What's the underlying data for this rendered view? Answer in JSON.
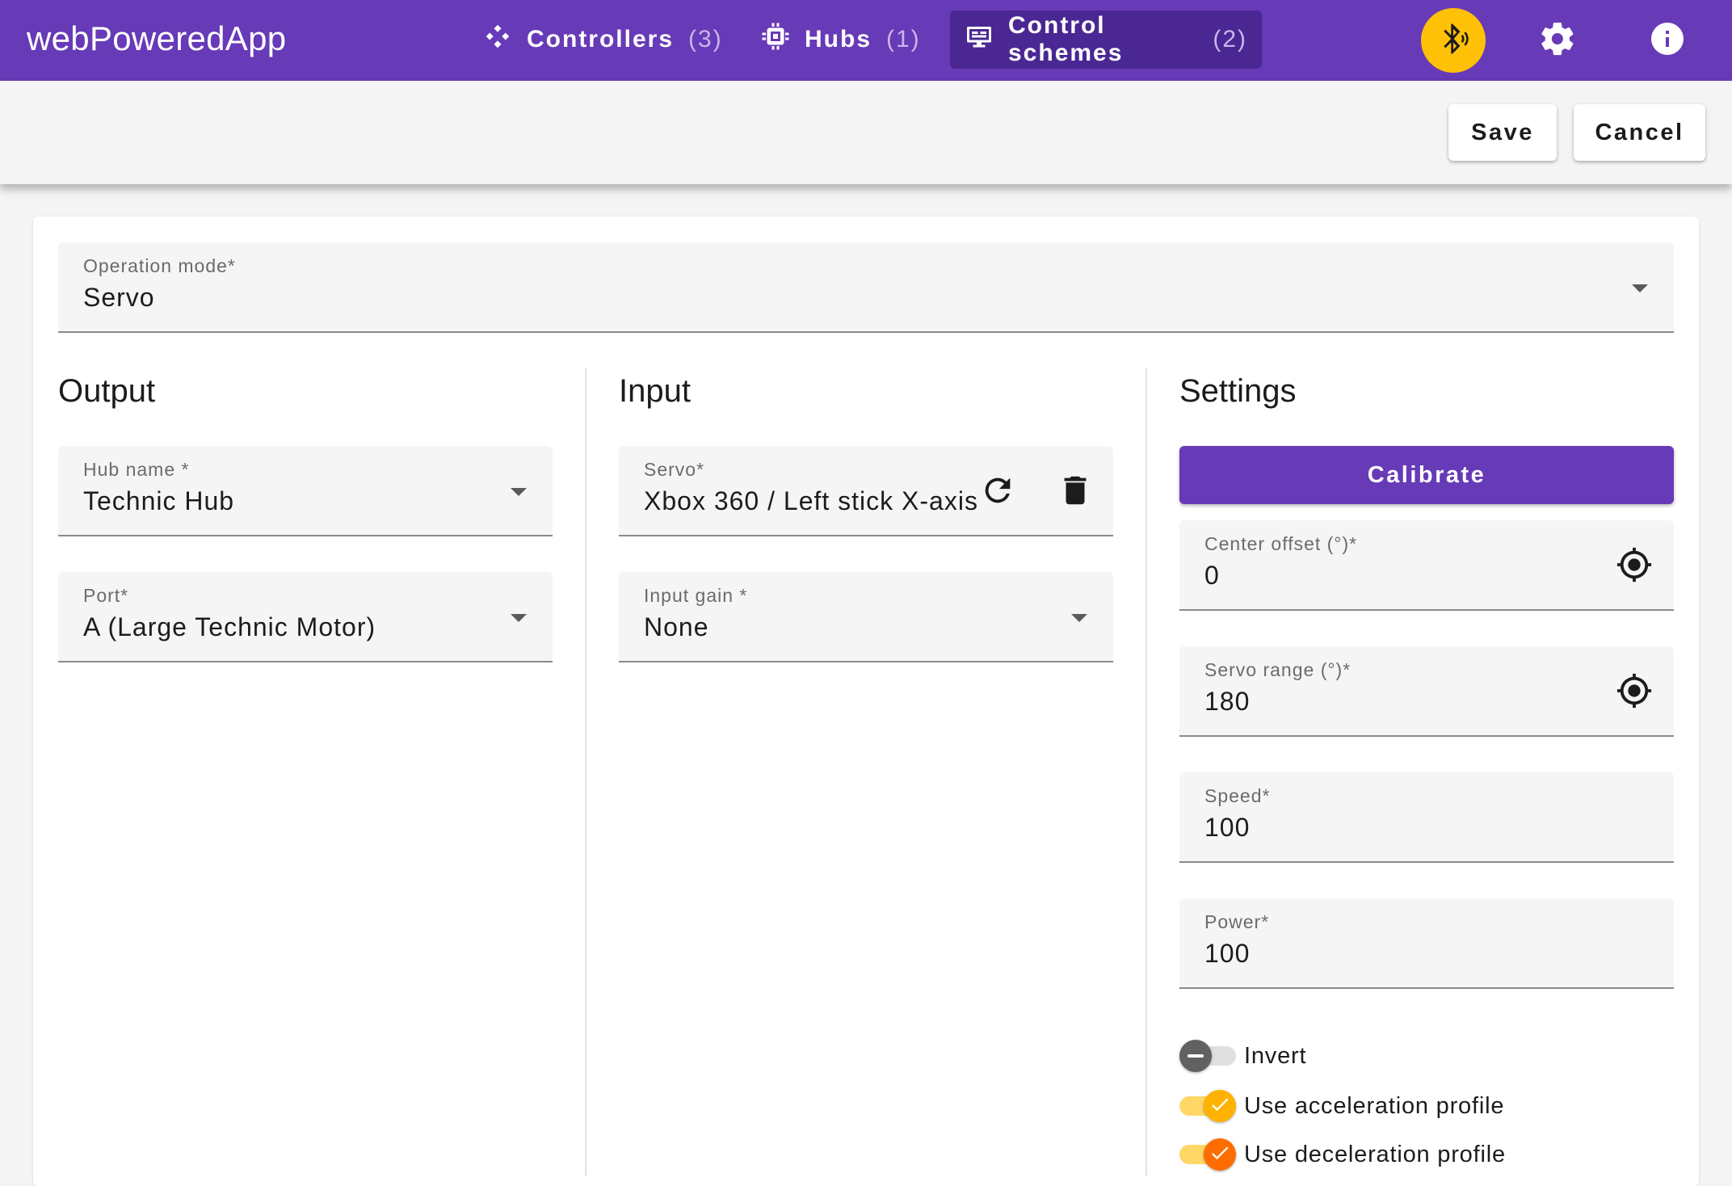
{
  "app": {
    "title": "webPoweredApp"
  },
  "nav": {
    "tabs": [
      {
        "label": "Controllers",
        "count": "(3)",
        "icon": "gamepad-icon"
      },
      {
        "label": "Hubs",
        "count": "(1)",
        "icon": "chip-icon"
      },
      {
        "label": "Control schemes",
        "count": "(2)",
        "icon": "control-scheme-icon",
        "active": true
      }
    ],
    "icons": [
      "bluetooth-icon",
      "gear-icon",
      "info-icon"
    ]
  },
  "actions": {
    "save_label": "Save",
    "cancel_label": "Cancel"
  },
  "form": {
    "operation_mode": {
      "label": "Operation mode*",
      "value": "Servo"
    },
    "output": {
      "title": "Output",
      "hub_name": {
        "label": "Hub name *",
        "value": "Technic Hub"
      },
      "port": {
        "label": "Port*",
        "value": "A (Large Technic Motor)"
      }
    },
    "input": {
      "title": "Input",
      "servo": {
        "label": "Servo*",
        "value": "Xbox 360 / Left stick X-axis"
      },
      "input_gain": {
        "label": "Input gain *",
        "value": "None"
      }
    },
    "settings": {
      "title": "Settings",
      "calibrate_label": "Calibrate",
      "center_offset": {
        "label": "Center offset (°)*",
        "value": "0"
      },
      "servo_range": {
        "label": "Servo range (°)*",
        "value": "180"
      },
      "speed": {
        "label": "Speed*",
        "value": "100"
      },
      "power": {
        "label": "Power*",
        "value": "100"
      },
      "toggles": [
        {
          "label": "Invert",
          "checked": false
        },
        {
          "label": "Use acceleration profile",
          "checked": true
        },
        {
          "label": "Use deceleration profile",
          "checked": true
        }
      ]
    }
  },
  "colors": {
    "primary": "#673ab7",
    "accent_bluetooth": "#ffc107",
    "toggle_accel": "#ffb300",
    "toggle_decel": "#ff6d00",
    "toggle_off": "#616161"
  }
}
